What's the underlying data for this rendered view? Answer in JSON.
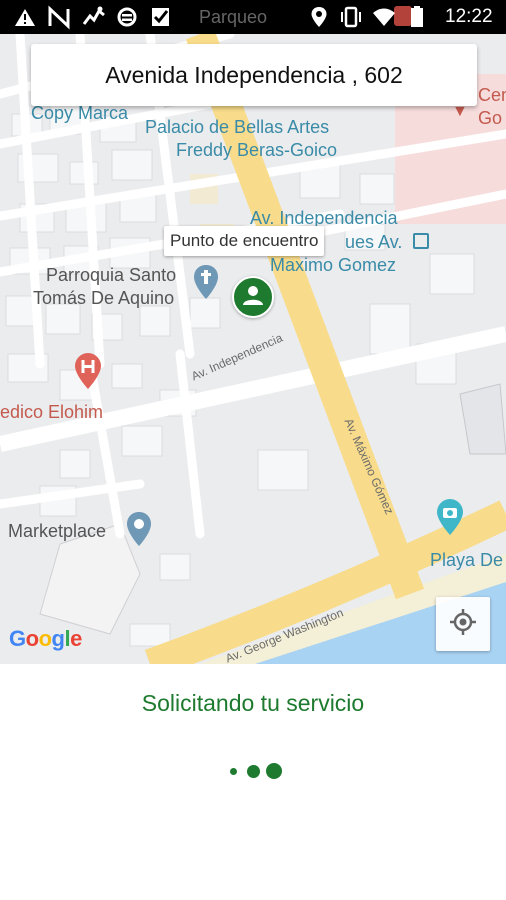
{
  "status_bar": {
    "carrier_label": "Parqueo",
    "time": "12:22",
    "left_icons": [
      "warning-icon",
      "network-n-icon",
      "activity-icon",
      "sync-icon",
      "check-square-icon"
    ],
    "right_icons": [
      "location-pin-icon",
      "vibrate-icon",
      "wifi-icon",
      "battery-icon"
    ]
  },
  "address_bar": {
    "text": "Avenida Independencia , 602"
  },
  "map": {
    "poi_labels": {
      "copy_marca": "Copy Marca",
      "bellas_artes_1": "Palacio de Bellas Artes",
      "bellas_artes_2": "Freddy Beras-Goico",
      "cen_1": "Cen",
      "cen_2": "Go",
      "parque_1": "Av. Independencia",
      "parque_2": "ues Av.",
      "parque_3": "Maximo Gomez",
      "parroquia_1": "Parroquia Santo",
      "parroquia_2": "Tomás De Aquino",
      "medico": "edico Elohim",
      "marketplace": "Marketplace",
      "playa": "Playa De"
    },
    "road_labels": {
      "independencia": "Av. Independencia",
      "maximo_gomez": "Av. Máximo Gómez",
      "george_washington": "Av. George Washington"
    },
    "callout_label": "Punto de encuentro",
    "attribution": {
      "letters": [
        "G",
        "o",
        "o",
        "g",
        "l",
        "e"
      ],
      "colors": [
        "#4285F4",
        "#EA4335",
        "#FBBC05",
        "#4285F4",
        "#34A853",
        "#EA4335"
      ]
    },
    "marker_icon": "person-icon",
    "locate_icon": "my-location-icon"
  },
  "status": {
    "message": "Solicitando tu servicio"
  },
  "colors": {
    "accent_green": "#1e7a2e",
    "road_yellow": "#f8dc8b",
    "water_blue": "#a9d3f3",
    "poi_blue": "#3a8ba8",
    "poi_red": "#c45a4e"
  }
}
